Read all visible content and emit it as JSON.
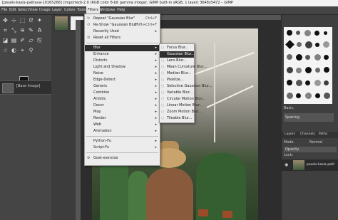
{
  "window": {
    "title": "[pexels-kasia-palitava-10165268] (imported)-2.0 (RGB color 8-bit gamma integer, GIMP built-in sRGB, 1 layer) 3648x5472 – GIMP"
  },
  "menubar": [
    "File",
    "Edit",
    "Select",
    "View",
    "Image",
    "Layer",
    "Colors",
    "Tools",
    "Filters",
    "Windows",
    "Help"
  ],
  "filters_menu": {
    "items": [
      {
        "label": "Repeat \"Gaussian Blur\"",
        "shortcut": "Ctrl+F"
      },
      {
        "label": "Re-Show \"Gaussian Blur\"",
        "shortcut": "Shift+Ctrl+F"
      },
      {
        "label": "Recently Used",
        "shortcut": "▸"
      },
      {
        "label": "Reset all Filters",
        "shortcut": ""
      },
      {
        "label": "Blur",
        "shortcut": "▸"
      },
      {
        "label": "Enhance",
        "shortcut": "▸"
      },
      {
        "label": "Distorts",
        "shortcut": "▸"
      },
      {
        "label": "Light and Shadow",
        "shortcut": "▸"
      },
      {
        "label": "Noise",
        "shortcut": "▸"
      },
      {
        "label": "Edge-Detect",
        "shortcut": "▸"
      },
      {
        "label": "Generic",
        "shortcut": "▸"
      },
      {
        "label": "Combine",
        "shortcut": "▸"
      },
      {
        "label": "Artistic",
        "shortcut": "▸"
      },
      {
        "label": "Decor",
        "shortcut": "▸"
      },
      {
        "label": "Map",
        "shortcut": "▸"
      },
      {
        "label": "Render",
        "shortcut": "▸"
      },
      {
        "label": "Web",
        "shortcut": "▸"
      },
      {
        "label": "Animation",
        "shortcut": "▸"
      },
      {
        "label": "Python-Fu",
        "shortcut": "▸"
      },
      {
        "label": "Script-Fu",
        "shortcut": "▸"
      },
      {
        "label": "Goat-exercise",
        "shortcut": ""
      }
    ]
  },
  "blur_submenu": {
    "items": [
      "Focus Blur...",
      "Gaussian Blur...",
      "Lens Blur...",
      "Mean Curvature Blur...",
      "Median Blur...",
      "Pixelize...",
      "Selective Gaussian Blur...",
      "Variable Blur...",
      "Circular Motion Blur...",
      "Linear Motion Blur...",
      "Zoom Motion Blur...",
      "Tileable Blur..."
    ]
  },
  "image_tab": {
    "label": "[Base Image]"
  },
  "brushes": {
    "preset_label": "Basic,",
    "spacing_label": "Spacing"
  },
  "layers": {
    "tabs": [
      "Layers",
      "Channels",
      "Paths"
    ],
    "mode_label": "Mode",
    "mode_value": "Normal",
    "opacity_label": "Opacity",
    "lock_label": "Lock:",
    "layer_name": "pexels-kasia-palit"
  },
  "colors": {
    "menu_bg": "#ececec",
    "highlight": "#2e2e2e",
    "panel": "#454545"
  }
}
